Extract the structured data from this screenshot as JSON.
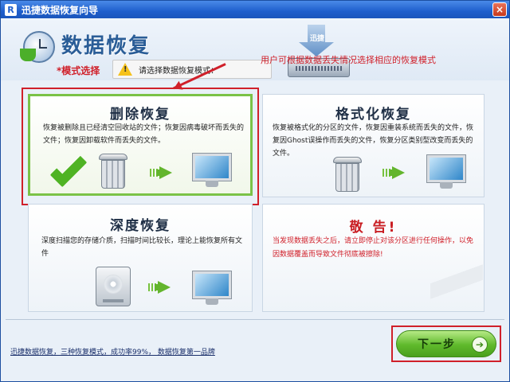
{
  "window": {
    "title": "迅捷数据恢复向导",
    "app_icon": "R",
    "close_glyph": "×"
  },
  "header": {
    "title": "数据恢复",
    "mode_label": "*模式选择",
    "hint": "请选择数据恢复模式：",
    "hdd_text": "迅捷",
    "annotation": "用户可根据数据丢失情况选择相应的恢复模式"
  },
  "cards": {
    "delete": {
      "title": "删除恢复",
      "desc": "恢复被删除且已经清空回收站的文件；恢复因病毒破坏而丢失的文件；恢复因卸载软件而丢失的文件。"
    },
    "format": {
      "title": "格式化恢复",
      "desc": "恢复被格式化的分区的文件，恢复因重装系统而丢失的文件，恢复因Ghost误操作而丢失的文件，恢复分区类别型改变而丢失的文件。"
    },
    "deep": {
      "title": "深度恢复",
      "desc": "深度扫描您的存储介质，扫描时间比较长，理论上能恢复所有文件"
    },
    "warning": {
      "title": "敬 告!",
      "desc": "当发现数据丢失之后，请立即停止对该分区进行任何操作，以免因数据覆盖而导致文件彻底被擦除!"
    }
  },
  "footer": {
    "link": "迅捷数据恢复，三种恢复模式，成功率99%， 数据恢复第一品牌",
    "next_label": "下一步",
    "next_glyph": "➔"
  },
  "colors": {
    "accent_red": "#d0202a",
    "accent_green": "#5fb92b",
    "title_blue": "#1f5fcc"
  }
}
